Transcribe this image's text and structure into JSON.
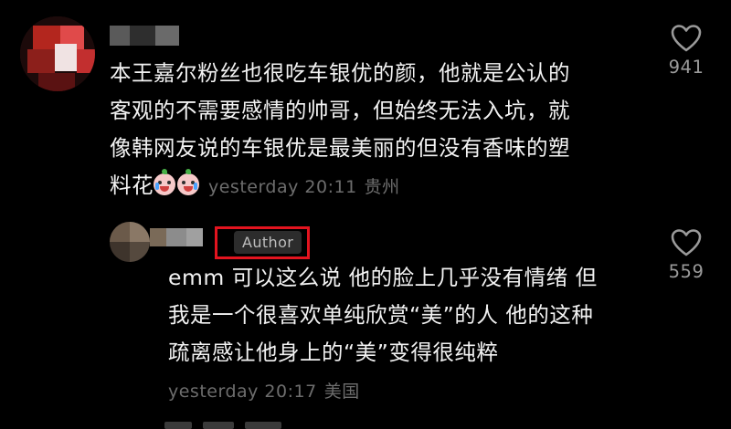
{
  "colors": {
    "background": "#000000",
    "text": "#f2f2f2",
    "meta_text": "#6d6d6d",
    "like_count": "#9a9a9a",
    "author_tag_bg": "#2c2c2c",
    "highlight": "#e3141f"
  },
  "comments": [
    {
      "username": "",
      "lines": [
        "本王嘉尔粉丝也很吃车银优的颜，他就是公认的",
        "客观的不需要感情的帅哥，但始终无法入坑，就",
        "像韩网友说的车银优是最美丽的但没有香味的塑",
        "料花"
      ],
      "emoji_icons": [
        "crying-face-icon",
        "crying-face-icon"
      ],
      "time": "yesterday 20:11",
      "location": "贵州",
      "like_icon": "heart-outline-icon",
      "likes": "941"
    },
    {
      "username": "",
      "author_tag": "Author",
      "lines": [
        "emm 可以这么说 他的脸上几乎没有情绪 但",
        "我是一个很喜欢单纯欣赏“美”的人 他的这种",
        "疏离感让他身上的“美”变得很纯粹"
      ],
      "time": "yesterday 20:17",
      "location": "美国",
      "like_icon": "heart-outline-icon",
      "likes": "559"
    }
  ]
}
